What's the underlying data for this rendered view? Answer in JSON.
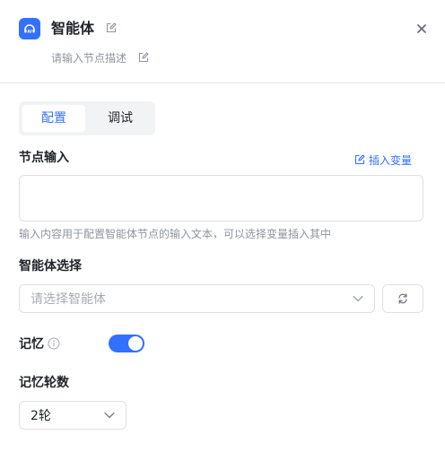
{
  "header": {
    "title": "智能体",
    "icon": "ai-agent-icon",
    "description_placeholder": "请输入节点描述",
    "accent_color": "#3370ff"
  },
  "tabs": [
    {
      "label": "配置",
      "active": true
    },
    {
      "label": "调试",
      "active": false
    }
  ],
  "node_input": {
    "label": "节点输入",
    "insert_variable": "插入变量",
    "value": "",
    "hint": "输入内容用于配置智能体节点的输入文本，可以选择变量插入其中"
  },
  "agent_select": {
    "label": "智能体选择",
    "placeholder": "请选择智能体",
    "refresh_icon": "refresh-icon"
  },
  "memory": {
    "label": "记忆",
    "enabled": true
  },
  "memory_rounds": {
    "label": "记忆轮数",
    "value": "2轮"
  }
}
